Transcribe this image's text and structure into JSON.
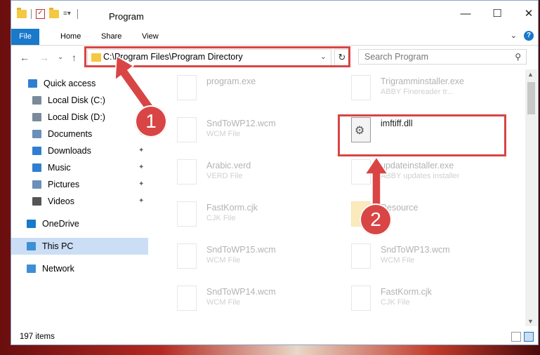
{
  "window": {
    "title": "Program"
  },
  "window_controls": {
    "minimize": "—",
    "maximize": "☐",
    "close": "✕"
  },
  "ribbon": {
    "tabs": [
      "File",
      "Home",
      "Share",
      "View"
    ],
    "expand_label": "⌄",
    "help_label": "?"
  },
  "nav": {
    "back": "←",
    "forward": "→",
    "recent": "⌄",
    "up": "↑"
  },
  "address": {
    "path": "C:\\Program Files\\Program Directory",
    "dropdown": "⌄",
    "refresh": "↻"
  },
  "search": {
    "placeholder": "Search Program",
    "icon": "search-icon"
  },
  "sidebar": {
    "items": [
      {
        "label": "Quick access",
        "icon": "star-icon",
        "color": "#2f7fd1",
        "pinned": false
      },
      {
        "label": "Local Disk (C:)",
        "icon": "drive-icon",
        "color": "#7a8a9a",
        "pinned": false
      },
      {
        "label": "Local Disk (D:)",
        "icon": "drive-icon",
        "color": "#7a8a9a",
        "pinned": false
      },
      {
        "label": "Documents",
        "icon": "documents-icon",
        "color": "#6b8fb8",
        "pinned": true
      },
      {
        "label": "Downloads",
        "icon": "download-icon",
        "color": "#2f7fd1",
        "pinned": true
      },
      {
        "label": "Music",
        "icon": "music-icon",
        "color": "#2f7fd1",
        "pinned": true
      },
      {
        "label": "Pictures",
        "icon": "pictures-icon",
        "color": "#6b8fb8",
        "pinned": true
      },
      {
        "label": "Videos",
        "icon": "videos-icon",
        "color": "#555555",
        "pinned": true
      },
      {
        "label": "OneDrive",
        "icon": "cloud-icon",
        "color": "#1979ca",
        "pinned": false
      },
      {
        "label": "This PC",
        "icon": "computer-icon",
        "color": "#3d8fd6",
        "pinned": false
      },
      {
        "label": "Network",
        "icon": "network-icon",
        "color": "#3d8fd6",
        "pinned": false
      }
    ],
    "pin_glyph": "📌"
  },
  "files": [
    {
      "name": "program.exe",
      "type": ""
    },
    {
      "name": "Trigramminstaller.exe",
      "type": "ABBY Finereader tr..."
    },
    {
      "name": "SndToWP12.wcm",
      "type": "WCM File"
    },
    {
      "name": "imftiff.dll",
      "type": ""
    },
    {
      "name": "Arabic.verd",
      "type": "VERD File"
    },
    {
      "name": "updateinstaller.exe",
      "type": "ABBY updates installer"
    },
    {
      "name": "FastKorm.cjk",
      "type": "CJK File"
    },
    {
      "name": "Resource",
      "type": ""
    },
    {
      "name": "SndToWP15.wcm",
      "type": "WCM File"
    },
    {
      "name": "SndToWP13.wcm",
      "type": "WCM File"
    },
    {
      "name": "SndToWP14.wcm",
      "type": "WCM File"
    },
    {
      "name": "FastKorm.cjk",
      "type": "CJK File"
    }
  ],
  "status": {
    "count": "197 items"
  },
  "callouts": [
    "1",
    "2"
  ],
  "colors": {
    "accent": "#1979ca",
    "highlight_red": "#d94545",
    "selection": "#ccdef5"
  }
}
